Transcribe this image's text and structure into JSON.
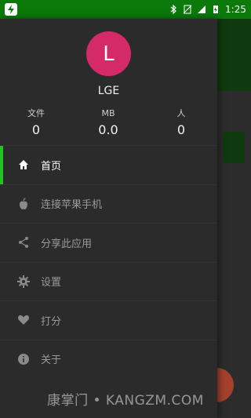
{
  "status_bar": {
    "time": "1:25",
    "icons": [
      "bluetooth-icon",
      "no-sim-icon",
      "signal-icon",
      "battery-charging-icon"
    ],
    "notification_icon": "app-flash-icon"
  },
  "profile": {
    "avatar_letter": "L",
    "avatar_color": "#d42a67",
    "name": "LGE",
    "stats": [
      {
        "label": "文件",
        "value": "0"
      },
      {
        "label": "MB",
        "value": "0.0"
      },
      {
        "label": "人",
        "value": "0"
      }
    ]
  },
  "menu": {
    "items": [
      {
        "label": "首页",
        "icon": "home-icon",
        "active": true
      },
      {
        "label": "连接苹果手机",
        "icon": "apple-icon",
        "active": false
      },
      {
        "label": "分享此应用",
        "icon": "share-icon",
        "active": false
      },
      {
        "label": "设置",
        "icon": "gear-icon",
        "active": false
      },
      {
        "label": "打分",
        "icon": "heart-icon",
        "active": false
      },
      {
        "label": "关于",
        "icon": "info-icon",
        "active": false
      }
    ]
  },
  "colors": {
    "accent": "#22c322",
    "status_bar": "#0b7a0b",
    "drawer_bg": "#2b2b2b"
  },
  "watermark": "康掌门 • KANGZM.COM"
}
